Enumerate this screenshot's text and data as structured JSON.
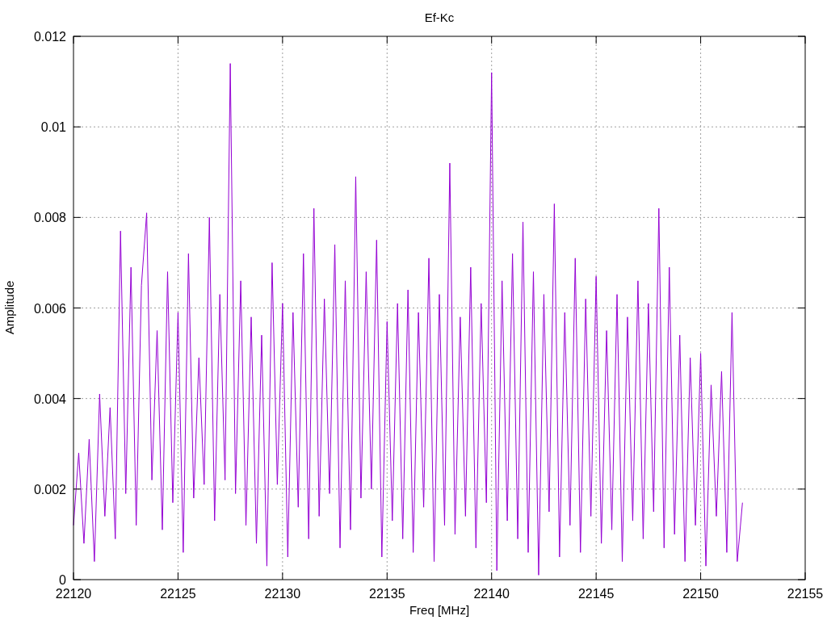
{
  "chart_data": {
    "type": "line",
    "title": "Ef-Kc",
    "xlabel": "Freq [MHz]",
    "ylabel": "Amplitude",
    "xlim": [
      22120,
      22155
    ],
    "ylim": [
      0,
      0.012
    ],
    "grid": true,
    "xticks": [
      22120,
      22125,
      22130,
      22135,
      22140,
      22145,
      22150,
      22155
    ],
    "yticks": [
      {
        "value": 0,
        "label": "0"
      },
      {
        "value": 0.002,
        "label": "0.002"
      },
      {
        "value": 0.004,
        "label": "0.004"
      },
      {
        "value": 0.006,
        "label": "0.006"
      },
      {
        "value": 0.008,
        "label": "0.008"
      },
      {
        "value": 0.01,
        "label": "0.01"
      },
      {
        "value": 0.012,
        "label": "0.012"
      }
    ],
    "x": [
      22120,
      22120.25,
      22120.5,
      22120.75,
      22121,
      22121.25,
      22121.5,
      22121.75,
      22122,
      22122.25,
      22122.5,
      22122.75,
      22123,
      22123.25,
      22123.5,
      22123.75,
      22124,
      22124.25,
      22124.5,
      22124.75,
      22125,
      22125.25,
      22125.5,
      22125.75,
      22126,
      22126.25,
      22126.5,
      22126.75,
      22127,
      22127.25,
      22127.5,
      22127.75,
      22128,
      22128.25,
      22128.5,
      22128.75,
      22129,
      22129.25,
      22129.5,
      22129.75,
      22130,
      22130.25,
      22130.5,
      22130.75,
      22131,
      22131.25,
      22131.5,
      22131.75,
      22132,
      22132.25,
      22132.5,
      22132.75,
      22133,
      22133.25,
      22133.5,
      22133.75,
      22134,
      22134.25,
      22134.5,
      22134.75,
      22135,
      22135.25,
      22135.5,
      22135.75,
      22136,
      22136.25,
      22136.5,
      22136.75,
      22137,
      22137.25,
      22137.5,
      22137.75,
      22138,
      22138.25,
      22138.5,
      22138.75,
      22139,
      22139.25,
      22139.5,
      22139.75,
      22140,
      22140.25,
      22140.5,
      22140.75,
      22141,
      22141.25,
      22141.5,
      22141.75,
      22142,
      22142.25,
      22142.5,
      22142.75,
      22143,
      22143.25,
      22143.5,
      22143.75,
      22144,
      22144.25,
      22144.5,
      22144.75,
      22145,
      22145.25,
      22145.5,
      22145.75,
      22146,
      22146.25,
      22146.5,
      22146.75,
      22147,
      22147.25,
      22147.5,
      22147.75,
      22148,
      22148.25,
      22148.5,
      22148.75,
      22149,
      22149.25,
      22149.5,
      22149.75,
      22150,
      22150.25,
      22150.5,
      22150.75,
      22151,
      22151.25,
      22151.5,
      22151.75,
      22152
    ],
    "series": [
      {
        "color": "#9400d3",
        "values": [
          0.0012,
          0.0028,
          0.0008,
          0.0031,
          0.0004,
          0.0041,
          0.0014,
          0.0038,
          0.0009,
          0.0077,
          0.0019,
          0.0069,
          0.0012,
          0.0065,
          0.0081,
          0.0022,
          0.0055,
          0.0011,
          0.0068,
          0.0017,
          0.0059,
          0.0006,
          0.0072,
          0.0018,
          0.0049,
          0.0021,
          0.008,
          0.0013,
          0.0063,
          0.0022,
          0.0114,
          0.0019,
          0.0066,
          0.0012,
          0.0058,
          0.0008,
          0.0054,
          0.0003,
          0.007,
          0.0021,
          0.0061,
          0.0005,
          0.0059,
          0.0016,
          0.0072,
          0.0009,
          0.0082,
          0.0014,
          0.0062,
          0.0019,
          0.0074,
          0.0007,
          0.0066,
          0.0011,
          0.0089,
          0.0018,
          0.0068,
          0.002,
          0.0075,
          0.0005,
          0.0057,
          0.0013,
          0.0061,
          0.0009,
          0.0064,
          0.0006,
          0.0059,
          0.0016,
          0.0071,
          0.0004,
          0.0063,
          0.0012,
          0.0092,
          0.001,
          0.0058,
          0.0014,
          0.0069,
          0.0007,
          0.0061,
          0.0017,
          0.0112,
          0.0002,
          0.0066,
          0.0013,
          0.0072,
          0.0009,
          0.0079,
          0.0006,
          0.0068,
          0.0001,
          0.0063,
          0.0015,
          0.0083,
          0.0005,
          0.0059,
          0.0012,
          0.0071,
          0.0006,
          0.0062,
          0.0014,
          0.0067,
          0.0008,
          0.0055,
          0.0011,
          0.0063,
          0.0004,
          0.0058,
          0.0013,
          0.0066,
          0.0009,
          0.0061,
          0.0015,
          0.0082,
          0.0007,
          0.0069,
          0.001,
          0.0054,
          0.0004,
          0.0049,
          0.0012,
          0.005,
          0.0003,
          0.0043,
          0.0014,
          0.0046,
          0.0006,
          0.0059,
          0.0004,
          0.0017
        ]
      }
    ]
  }
}
